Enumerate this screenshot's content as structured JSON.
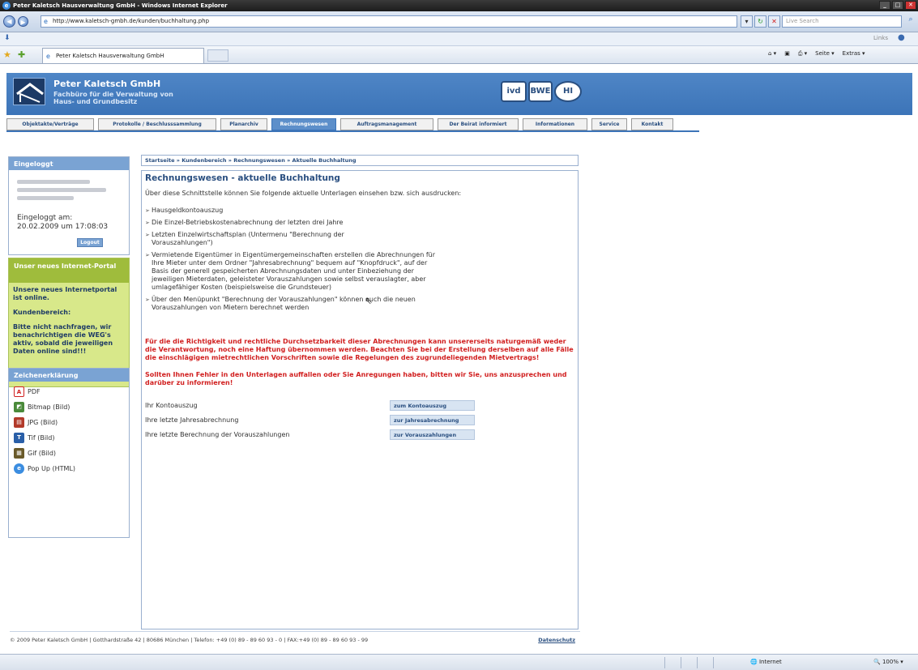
{
  "browser": {
    "window_title": "Peter Kaletsch Hausverwaltung GmbH - Windows Internet Explorer",
    "url": "http://www.kaletsch-gmbh.de/kunden/buchhaltung.php",
    "search_placeholder": "Live Search",
    "links_label": "Links",
    "tab_title": "Peter Kaletsch Hausverwaltung GmbH",
    "cmd_page": "Seite ▾",
    "cmd_extras": "Extras ▾",
    "status_zone": "Internet",
    "status_zoom": "100%"
  },
  "header": {
    "company_name": "Peter Kaletsch GmbH",
    "company_sub1": "Fachbüro für die Verwaltung von",
    "company_sub2": "Haus- und Grundbesitz",
    "logo_ivd": "ivd",
    "logo_bwe": "BWE",
    "logo_hi": "HI"
  },
  "nav": {
    "tabs": [
      "Objektakte/Verträge",
      "Protokolle / Beschlusssammlung",
      "Planarchiv",
      "Rechnungswesen",
      "Auftragsmanagement",
      "Der Beirat informiert",
      "Informationen",
      "Service",
      "Kontakt"
    ]
  },
  "sidebar": {
    "login_title": "Eingeloggt",
    "logged_in_label": "Eingeloggt am:",
    "logged_in_time": "20.02.2009 um 17:08:03",
    "logout_label": "Logout",
    "portal_title": "Unser neues Internet-Portal",
    "portal_text1": "Unsere neues Internetportal ist online.",
    "portal_text2": "Kundenbereich:",
    "portal_text3": "Bitte nicht nachfragen, wir benachrichtigen die WEG's aktiv, sobald die jeweiligen Daten online sind!!!",
    "legend_title": "Zeichenerklärung",
    "legend": [
      "PDF",
      "Bitmap (Bild)",
      "JPG (Bild)",
      "Tif (Bild)",
      "Gif (Bild)",
      "Pop Up (HTML)"
    ]
  },
  "breadcrumb": "Startseite » Kundenbereich » Rechnungswesen » Aktuelle Buchhaltung",
  "main": {
    "title": "Rechnungswesen - aktuelle Buchhaltung",
    "intro": "Über diese Schnittstelle können Sie folgende aktuelle Unterlagen einsehen bzw. sich ausdrucken:",
    "bullets": [
      "Hausgeldkontoauszug",
      "Die Einzel-Betriebskostenabrechnung der letzten drei Jahre",
      "Letzten Einzelwirtschaftsplan (Untermenu \"Berechnung der Vorauszahlungen\")",
      "Vermietende Eigentümer in Eigentümergemeinschaften erstellen die Abrechnungen für Ihre Mieter unter dem Ordner \"Jahresabrechnung\" bequem auf \"Knopfdruck\", auf der Basis der generell gespeicherten Abrechnungsdaten und unter Einbeziehung der jeweiligen Mieterdaten, geleisteter Vorauszahlungen sowie selbst verauslagter, aber umlagefähiger Kosten (beispielsweise die Grundsteuer)",
      "Über den Menüpunkt \"Berechnung der Vorauszahlungen\" können auch die neuen Vorauszahlungen von Mietern berechnet werden"
    ],
    "warning1": "Für die die Richtigkeit und rechtliche Durchsetzbarkeit dieser Abrechnungen kann unsererseits naturgemäß weder die Verantwortung, noch eine Haftung übernommen werden. Beachten Sie bei der Erstellung derselben auf alle Fälle die einschlägigen mietrechtlichen Vorschriften sowie die Regelungen des zugrundeliegenden Mietvertrags!",
    "warning2": "Sollten Ihnen Fehler in den Unterlagen auffallen oder Sie Anregungen haben, bitten wir Sie, uns anzusprechen und darüber zu informieren!",
    "rows": [
      {
        "label": "Ihr Kontoauszug",
        "link": "zum Kontoauszug"
      },
      {
        "label": "Ihre letzte Jahresabrechnung",
        "link": "zur Jahresabrechnung"
      },
      {
        "label": "Ihre letzte Berechnung der Vorauszahlungen",
        "link": "zur Vorauszahlungen"
      }
    ]
  },
  "footer": {
    "text": "© 2009 Peter Kaletsch GmbH | Gotthardstraße 42 | 80686 München | Telefon: +49 (0) 89 - 89 60 93 - 0 | FAX:+49 (0) 89 - 89 60 93 - 99",
    "datenschutz": "Datenschutz"
  }
}
